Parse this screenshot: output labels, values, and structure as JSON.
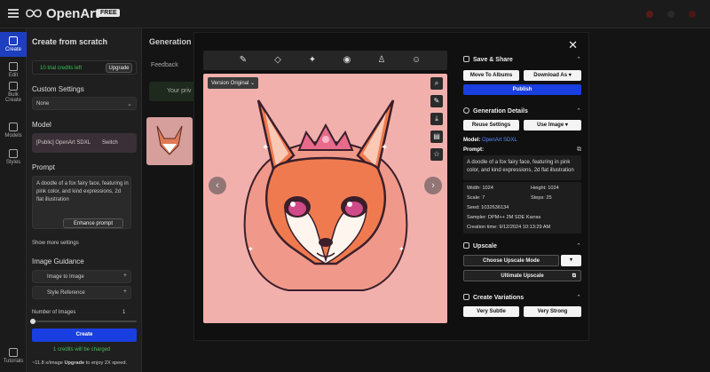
{
  "app": {
    "logo_text": "OpenArt",
    "plan_badge": "FREE"
  },
  "rail": [
    {
      "label": "Create",
      "active": true
    },
    {
      "label": "Edit"
    },
    {
      "label": "Bulk Create"
    },
    {
      "label": "Models"
    },
    {
      "label": "Styles"
    },
    {
      "label": "Tutorials"
    }
  ],
  "left_panel": {
    "title": "Create from scratch",
    "credits_text": "10 trial credits left",
    "upgrade_label": "Upgrade",
    "custom_settings": "Custom Settings",
    "custom_value": "None",
    "model_head": "Model",
    "model_value": "[Public] OpenArt SDXL",
    "switch_label": "Switch",
    "prompt_head": "Prompt",
    "prompt_text": "A doodle of a fox fairy face, featuring in pink color, and kind expressions, 2d flat illustration",
    "enhance_label": "Enhance prompt",
    "show_more": "Show more settings",
    "guidance_head": "Image Guidance",
    "image_to_image": "Image to Image",
    "style_reference": "Style Reference",
    "num_images_label": "Number of Images",
    "num_images_value": "1",
    "create_label": "Create",
    "charge_note": "1 credits will be charged",
    "speed_prefix": "~11.8 s/image",
    "speed_link": "Upgrade",
    "speed_suffix": "to enjoy 2X speed."
  },
  "gen_area": {
    "title": "Generation",
    "feedback_label": "Feedback",
    "notice_text": "Your priv"
  },
  "modal": {
    "version_label": "Version Original",
    "close_label": "✕",
    "save_share": {
      "head": "Save & Share",
      "move_label": "Move To Albums",
      "download_label": "Download As",
      "publish_label": "Publish"
    },
    "details": {
      "head": "Generation Details",
      "reuse_label": "Reuse Settings",
      "use_image_label": "Use Image",
      "model_key": "Model:",
      "model_value": "OpenArt SDXL",
      "prompt_key": "Prompt:",
      "prompt_text": "A doodle of a fox fairy face, featuring in pink color, and kind expressions, 2d flat illustration",
      "width": "Width: 1024",
      "height": "Height: 1024",
      "scale": "Scale: 7",
      "steps": "Steps: 25",
      "seed": "Seed: 1032636134",
      "sampler": "Sampler: DPM++ 2M SDE Karras",
      "created": "Creation time: 9/12/2024 10:13:29 AM"
    },
    "upscale": {
      "head": "Upscale",
      "choose_label": "Choose Upscale Mode",
      "ultimate_label": "Ultimate Upscale"
    },
    "variations": {
      "head": "Create Variations",
      "subtle_label": "Very Subtle",
      "strong_label": "Very Strong"
    }
  },
  "colors": {
    "accent": "#1a3fe0",
    "image_bg": "#f2b0ad",
    "fox_orange": "#f07a4f"
  }
}
